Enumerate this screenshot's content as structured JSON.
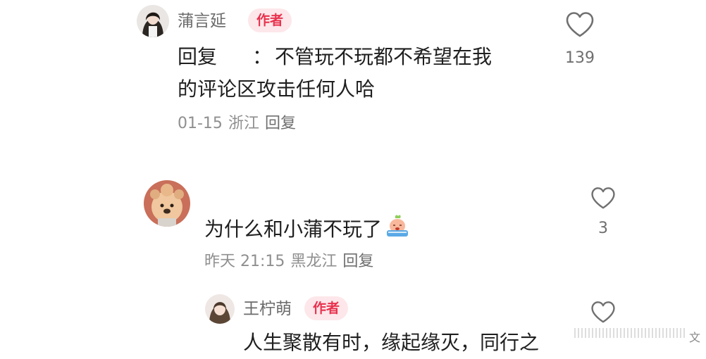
{
  "comment1": {
    "username": "蒲言延",
    "badge": "作者",
    "content_prefix": "回复",
    "content_sep": "：",
    "content_line1": "不管玩不玩都不希望在我",
    "content_line2": "的评论区攻击任何人哈",
    "date": "01-15",
    "location": "浙江",
    "reply_label": "回复",
    "likes": "139"
  },
  "comment2": {
    "content": "为什么和小蒲不玩了",
    "date": "昨天 21:15",
    "location": "黑龙江",
    "reply_label": "回复",
    "likes": "3"
  },
  "comment3": {
    "username": "王柠萌",
    "badge": "作者",
    "content_partial": "人生聚散有时，缘起缘灭，同行之",
    "edge_text": "文"
  },
  "colors": {
    "badge_bg": "#fde7ea",
    "badge_text": "#e8324e",
    "meta": "#8f8f8f",
    "name": "#6b6b6b"
  },
  "icons": [
    "heart-outline-icon",
    "crying-emoji-icon"
  ]
}
